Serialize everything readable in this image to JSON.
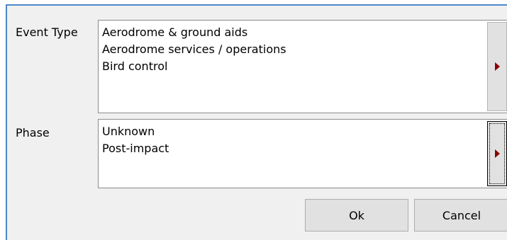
{
  "event_type": {
    "label": "Event Type",
    "items": [
      "Aerodrome & ground aids",
      "Aerodrome services / operations",
      "Bird control"
    ]
  },
  "phase": {
    "label": "Phase",
    "items": [
      "Unknown",
      "Post-impact"
    ]
  },
  "buttons": {
    "ok_label": "Ok",
    "cancel_label": "Cancel"
  },
  "icons": {
    "scroll_arrow": "arrow-right-icon"
  },
  "colors": {
    "arrow": "#8b0000",
    "window_border": "#4c88c9",
    "panel_bg": "#f0f0f0"
  }
}
